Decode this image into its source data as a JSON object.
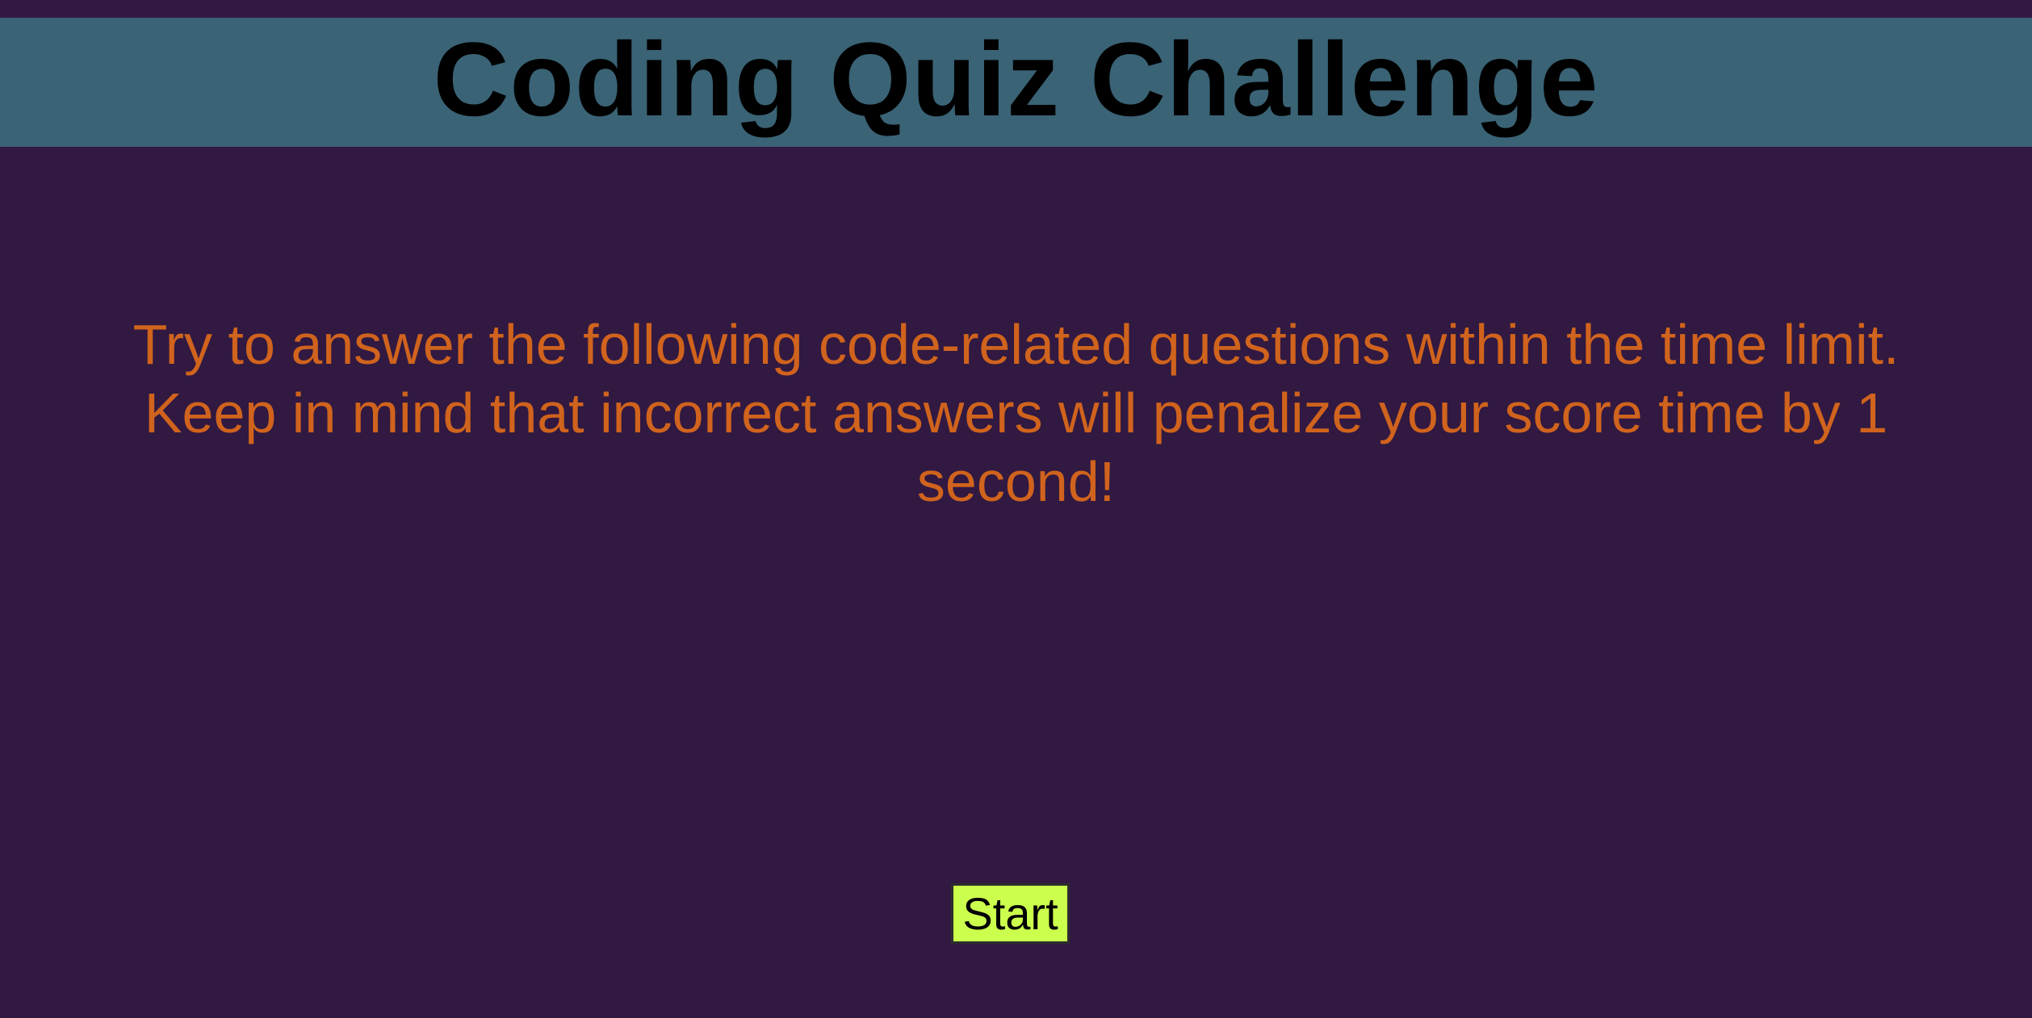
{
  "header": {
    "title": "Coding Quiz Challenge"
  },
  "main": {
    "intro_text": "Try to answer the following code-related questions within the time limit. Keep in mind that incorrect answers will penalize your score time by 1 second!",
    "start_label": "Start"
  },
  "colors": {
    "background": "#311941",
    "header_bar": "#3a6375",
    "title_text": "#000000",
    "intro_text": "#d0631d",
    "start_button": "#ccff4d"
  }
}
